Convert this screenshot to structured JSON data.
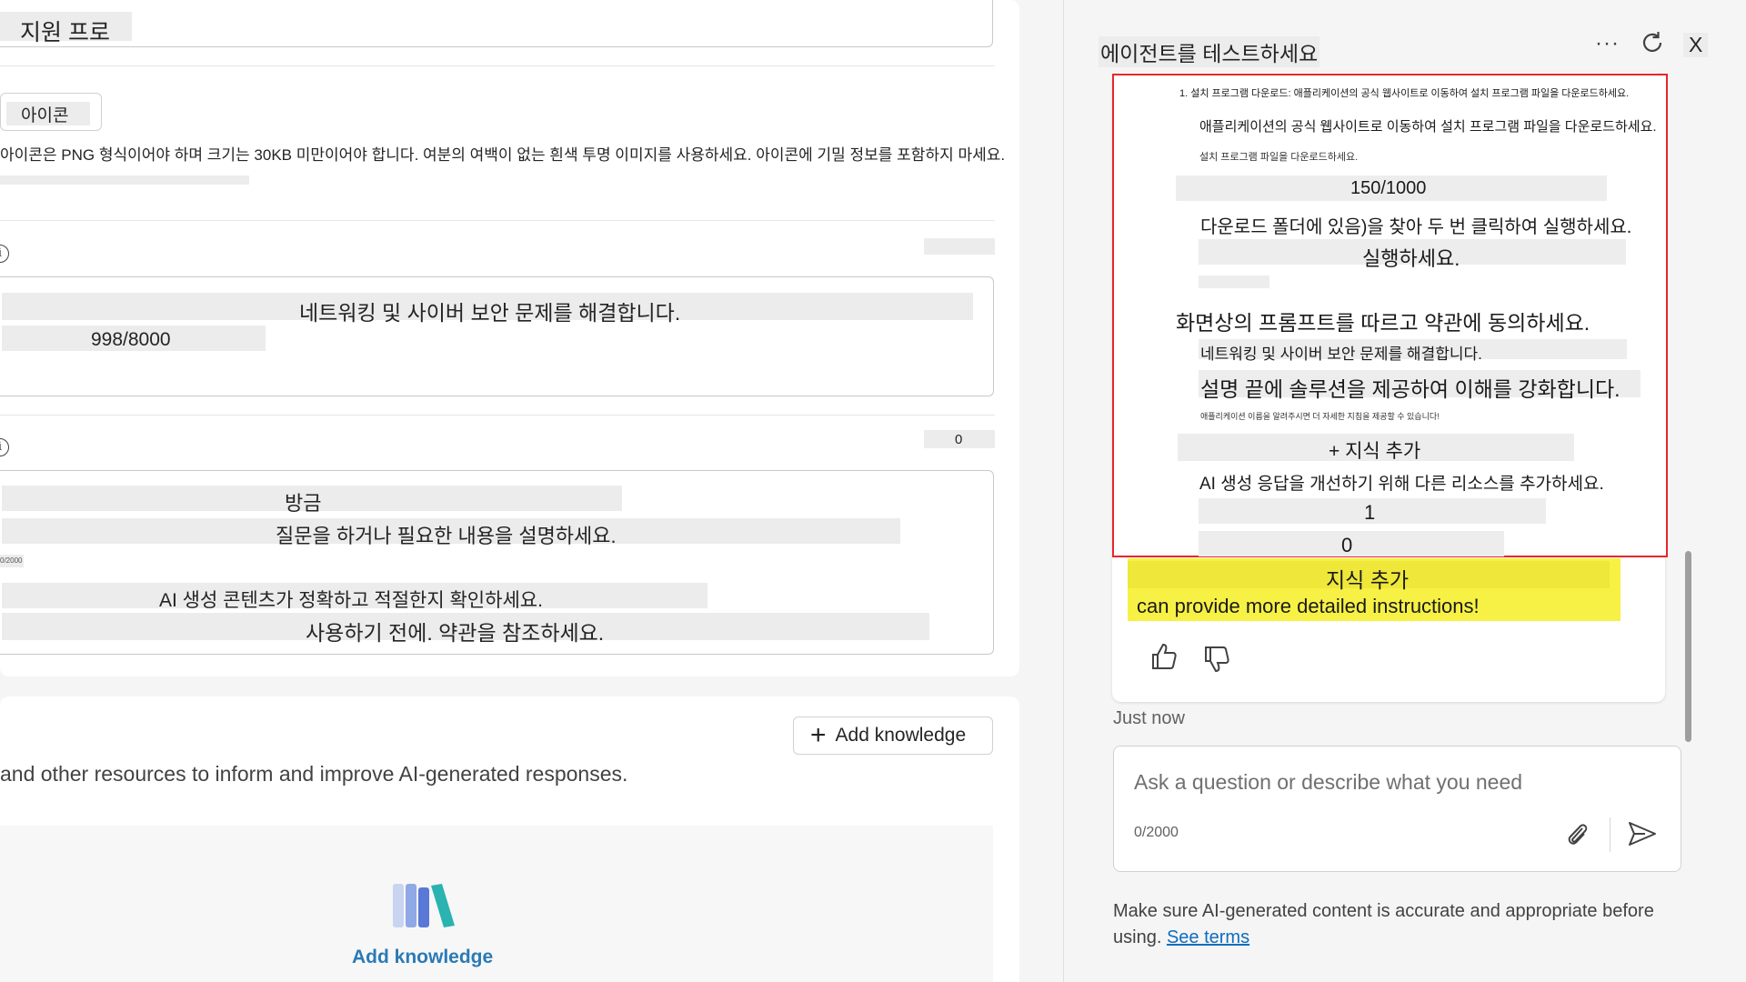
{
  "form": {
    "name_value": "지원 프로",
    "icon_button_label": "아이콘",
    "icon_help": "아이콘은 PNG 형식이어야 하며 크기는 30KB 미만이어야 합니다. 여분의 여백이 없는 흰색 투명 이미지를 사용하세요. 아이콘에 기밀 정보를 포함하지 마세요.",
    "description_value": "네트워킹 및 사이버 보안 문제를 해결합니다.",
    "description_count": "998/8000",
    "instructions_count": "0",
    "instructions_line1": "방금",
    "instructions_line2": "질문을 하거나 필요한 내용을 설명하세요.",
    "instructions_small_count": "0/2000",
    "instructions_line3": "AI 생성 콘텐츠가 정확하고 적절한지 확인하세요.",
    "instructions_line4": "사용하기 전에. 약관을 참조하세요."
  },
  "knowledge": {
    "add_button_label": "Add knowledge",
    "description": "and other resources to inform and improve AI-generated responses.",
    "empty_cta": "Add knowledge"
  },
  "test_panel": {
    "title": "에이전트를 테스트하세요",
    "close_label": "X",
    "overlay": {
      "line1": "1. 설치 프로그램 다운로드: 애플리케이션의 공식 웹사이트로 이동하여 설치 프로그램 파일을 다운로드하세요.",
      "line2": "애플리케이션의 공식 웹사이트로 이동하여 설치 프로그램 파일을 다운로드하세요.",
      "line3": "설치 프로그램 파일을 다운로드하세요.",
      "line4": "150/1000",
      "line5": "다운로드 폴더에 있음)을 찾아 두 번 클릭하여 실행하세요.",
      "line6": "실행하세요.",
      "line7": "화면상의 프롬프트를 따르고 약관에 동의하세요.",
      "line8": "네트워킹 및 사이버 보안 문제를 해결합니다.",
      "line9": "설명 끝에 솔루션을 제공하여 이해를 강화합니다.",
      "line10": "애플리케이션 이름을 알려주시면 더 자세한 지침을 제공할 수 있습니다!",
      "line11": "+ 지식 추가",
      "line12": "AI 생성 응답을 개선하기 위해 다른 리소스를 추가하세요.",
      "line13": "1",
      "line14": "0"
    },
    "highlight_title": "지식 추가",
    "highlight_text": "can provide more detailed instructions!",
    "timestamp": "Just now",
    "input_placeholder": "Ask a question or describe what you need",
    "input_counter": "0/2000",
    "disclaimer": "Make sure AI-generated content is accurate and appropriate before using.",
    "see_terms": "See terms"
  },
  "colors": {
    "accent": "#0f6cbd",
    "highlight": "#f7f146",
    "overlay_border": "#e8262b"
  }
}
